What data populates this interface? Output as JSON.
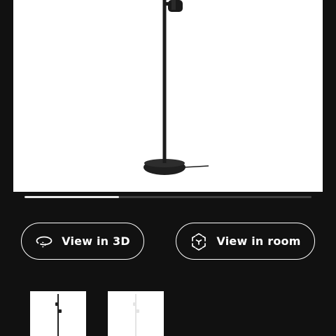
{
  "product_image": {
    "icon": "floor-lamp-black-image"
  },
  "gallery_progress": {
    "fraction": 0.33
  },
  "actions": {
    "view_3d_label": "View in 3D",
    "view_3d_icon": "rotate-3d-icon",
    "view_room_label": "View in room",
    "view_room_icon": "augmented-reality-cube-icon"
  },
  "thumbnails": [
    {
      "icon": "floor-lamp-black-two-spots-thumbnail"
    },
    {
      "icon": "floor-lamp-white-two-spots-thumbnail"
    }
  ],
  "colors": {
    "background": "#111111",
    "progress_fill": "#e9e9e9",
    "progress_track": "#3f3f3f",
    "button_border": "#ffffff"
  }
}
